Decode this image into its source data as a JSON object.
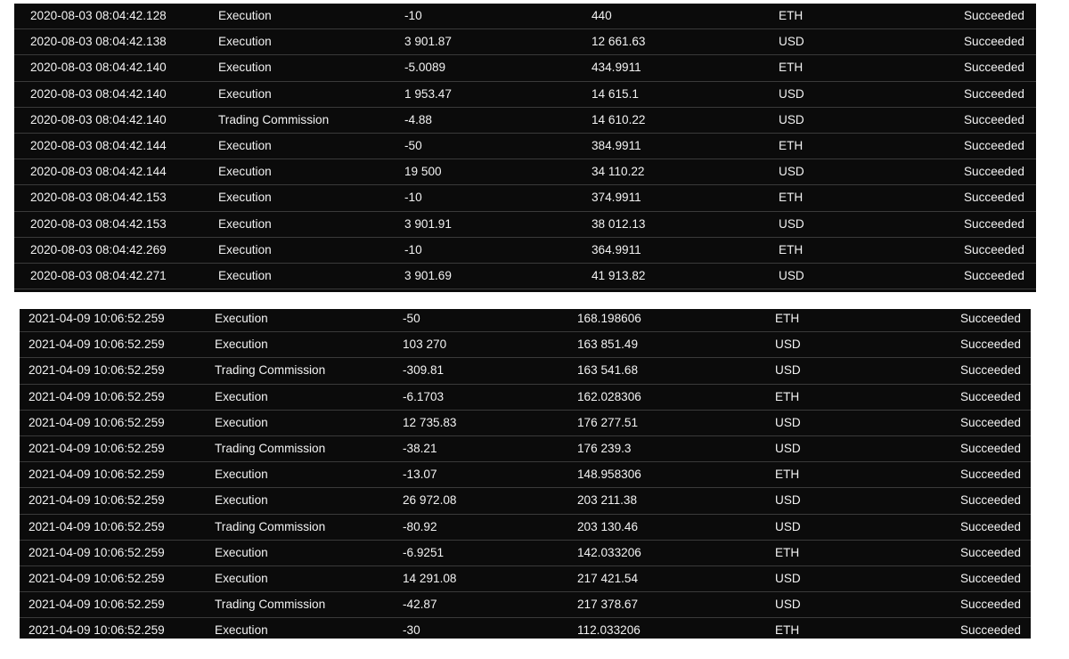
{
  "panels": [
    {
      "rows": [
        {
          "time": "2020-08-03 08:04:42.128",
          "type": "Execution",
          "amount": "-10",
          "balance": "440",
          "currency": "ETH",
          "status": "Succeeded"
        },
        {
          "time": "2020-08-03 08:04:42.138",
          "type": "Execution",
          "amount": "3 901.87",
          "balance": "12 661.63",
          "currency": "USD",
          "status": "Succeeded"
        },
        {
          "time": "2020-08-03 08:04:42.140",
          "type": "Execution",
          "amount": "-5.0089",
          "balance": "434.9911",
          "currency": "ETH",
          "status": "Succeeded"
        },
        {
          "time": "2020-08-03 08:04:42.140",
          "type": "Execution",
          "amount": "1 953.47",
          "balance": "14 615.1",
          "currency": "USD",
          "status": "Succeeded"
        },
        {
          "time": "2020-08-03 08:04:42.140",
          "type": "Trading Commission",
          "amount": "-4.88",
          "balance": "14 610.22",
          "currency": "USD",
          "status": "Succeeded"
        },
        {
          "time": "2020-08-03 08:04:42.144",
          "type": "Execution",
          "amount": "-50",
          "balance": "384.9911",
          "currency": "ETH",
          "status": "Succeeded"
        },
        {
          "time": "2020-08-03 08:04:42.144",
          "type": "Execution",
          "amount": "19 500",
          "balance": "34 110.22",
          "currency": "USD",
          "status": "Succeeded"
        },
        {
          "time": "2020-08-03 08:04:42.153",
          "type": "Execution",
          "amount": "-10",
          "balance": "374.9911",
          "currency": "ETH",
          "status": "Succeeded"
        },
        {
          "time": "2020-08-03 08:04:42.153",
          "type": "Execution",
          "amount": "3 901.91",
          "balance": "38 012.13",
          "currency": "USD",
          "status": "Succeeded"
        },
        {
          "time": "2020-08-03 08:04:42.269",
          "type": "Execution",
          "amount": "-10",
          "balance": "364.9911",
          "currency": "ETH",
          "status": "Succeeded"
        },
        {
          "time": "2020-08-03 08:04:42.271",
          "type": "Execution",
          "amount": "3 901.69",
          "balance": "41 913.82",
          "currency": "USD",
          "status": "Succeeded"
        }
      ]
    },
    {
      "rows": [
        {
          "time": "2021-04-09 10:06:52.259",
          "type": "Execution",
          "amount": "-50",
          "balance": "168.198606",
          "currency": "ETH",
          "status": "Succeeded"
        },
        {
          "time": "2021-04-09 10:06:52.259",
          "type": "Execution",
          "amount": "103 270",
          "balance": "163 851.49",
          "currency": "USD",
          "status": "Succeeded"
        },
        {
          "time": "2021-04-09 10:06:52.259",
          "type": "Trading Commission",
          "amount": "-309.81",
          "balance": "163 541.68",
          "currency": "USD",
          "status": "Succeeded"
        },
        {
          "time": "2021-04-09 10:06:52.259",
          "type": "Execution",
          "amount": "-6.1703",
          "balance": "162.028306",
          "currency": "ETH",
          "status": "Succeeded"
        },
        {
          "time": "2021-04-09 10:06:52.259",
          "type": "Execution",
          "amount": "12 735.83",
          "balance": "176 277.51",
          "currency": "USD",
          "status": "Succeeded"
        },
        {
          "time": "2021-04-09 10:06:52.259",
          "type": "Trading Commission",
          "amount": "-38.21",
          "balance": "176 239.3",
          "currency": "USD",
          "status": "Succeeded"
        },
        {
          "time": "2021-04-09 10:06:52.259",
          "type": "Execution",
          "amount": "-13.07",
          "balance": "148.958306",
          "currency": "ETH",
          "status": "Succeeded"
        },
        {
          "time": "2021-04-09 10:06:52.259",
          "type": "Execution",
          "amount": "26 972.08",
          "balance": "203 211.38",
          "currency": "USD",
          "status": "Succeeded"
        },
        {
          "time": "2021-04-09 10:06:52.259",
          "type": "Trading Commission",
          "amount": "-80.92",
          "balance": "203 130.46",
          "currency": "USD",
          "status": "Succeeded"
        },
        {
          "time": "2021-04-09 10:06:52.259",
          "type": "Execution",
          "amount": "-6.9251",
          "balance": "142.033206",
          "currency": "ETH",
          "status": "Succeeded"
        },
        {
          "time": "2021-04-09 10:06:52.259",
          "type": "Execution",
          "amount": "14 291.08",
          "balance": "217 421.54",
          "currency": "USD",
          "status": "Succeeded"
        },
        {
          "time": "2021-04-09 10:06:52.259",
          "type": "Trading Commission",
          "amount": "-42.87",
          "balance": "217 378.67",
          "currency": "USD",
          "status": "Succeeded"
        },
        {
          "time": "2021-04-09 10:06:52.259",
          "type": "Execution",
          "amount": "-30",
          "balance": "112.033206",
          "currency": "ETH",
          "status": "Succeeded"
        }
      ]
    }
  ]
}
